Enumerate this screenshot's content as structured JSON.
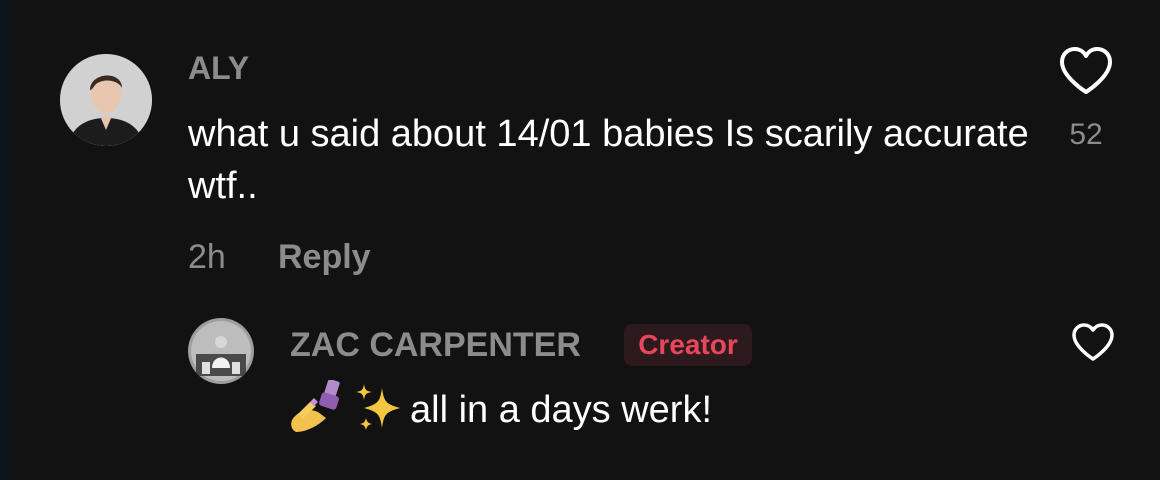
{
  "comments": [
    {
      "username": "ALY",
      "text": "what u said about 14/01 babies Is scarily accurate wtf..",
      "time": "2h",
      "reply_label": "Reply",
      "like_count": "52"
    }
  ],
  "reply": {
    "username": "ZAC CARPENTER",
    "badge": "Creator",
    "text": "all in a days werk!",
    "emojis": [
      "nail-polish-icon",
      "sparkles-icon"
    ]
  },
  "colors": {
    "background": "#121212",
    "muted_text": "#8c8c8c",
    "creator_badge_text": "#e8475b",
    "creator_badge_bg": "#2c1a1e"
  }
}
